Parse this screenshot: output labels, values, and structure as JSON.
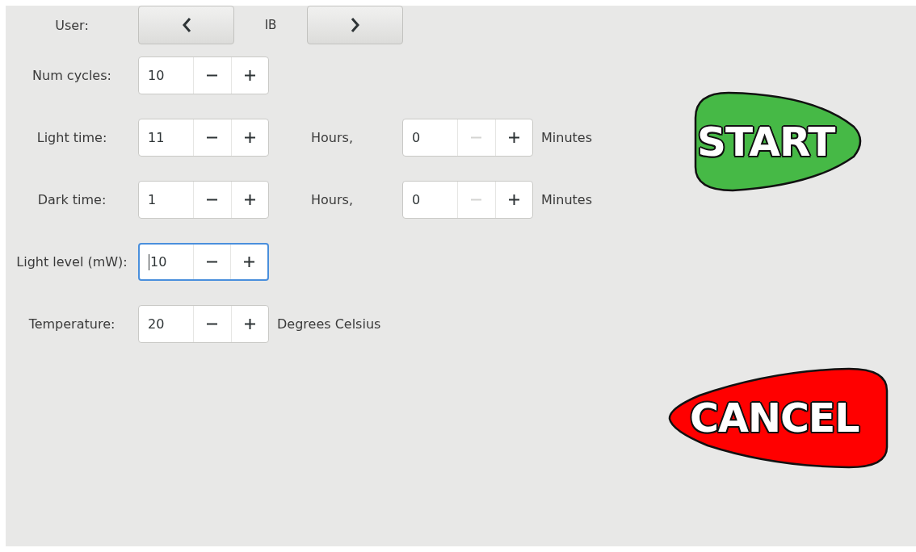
{
  "user": {
    "label": "User:",
    "value": "IB"
  },
  "rows": [
    {
      "label": "Num cycles:",
      "spin": {
        "value": "10",
        "focused": false,
        "minus_disabled": false
      },
      "after": []
    },
    {
      "label": "Light time:",
      "spin": {
        "value": "11",
        "focused": false,
        "minus_disabled": false
      },
      "after": [
        {
          "kind": "separator",
          "text": "Hours,"
        },
        {
          "kind": "spin",
          "value": "0",
          "focused": false,
          "minus_disabled": true
        },
        {
          "kind": "unit",
          "text": "Minutes"
        }
      ]
    },
    {
      "label": "Dark time:",
      "spin": {
        "value": "1",
        "focused": false,
        "minus_disabled": false
      },
      "after": [
        {
          "kind": "separator",
          "text": "Hours,"
        },
        {
          "kind": "spin",
          "value": "0",
          "focused": false,
          "minus_disabled": true
        },
        {
          "kind": "unit",
          "text": "Minutes"
        }
      ]
    },
    {
      "label": "Light level (mW):",
      "spin": {
        "value": "10",
        "focused": true,
        "minus_disabled": false
      },
      "after": []
    },
    {
      "label": "Temperature:",
      "spin": {
        "value": "20",
        "focused": false,
        "minus_disabled": false
      },
      "after": [
        {
          "kind": "unit",
          "text": "Degrees Celsius"
        }
      ]
    }
  ],
  "actions": [
    {
      "kind": "start",
      "label": "START"
    },
    {
      "kind": "cancel",
      "label": "CANCEL"
    }
  ]
}
